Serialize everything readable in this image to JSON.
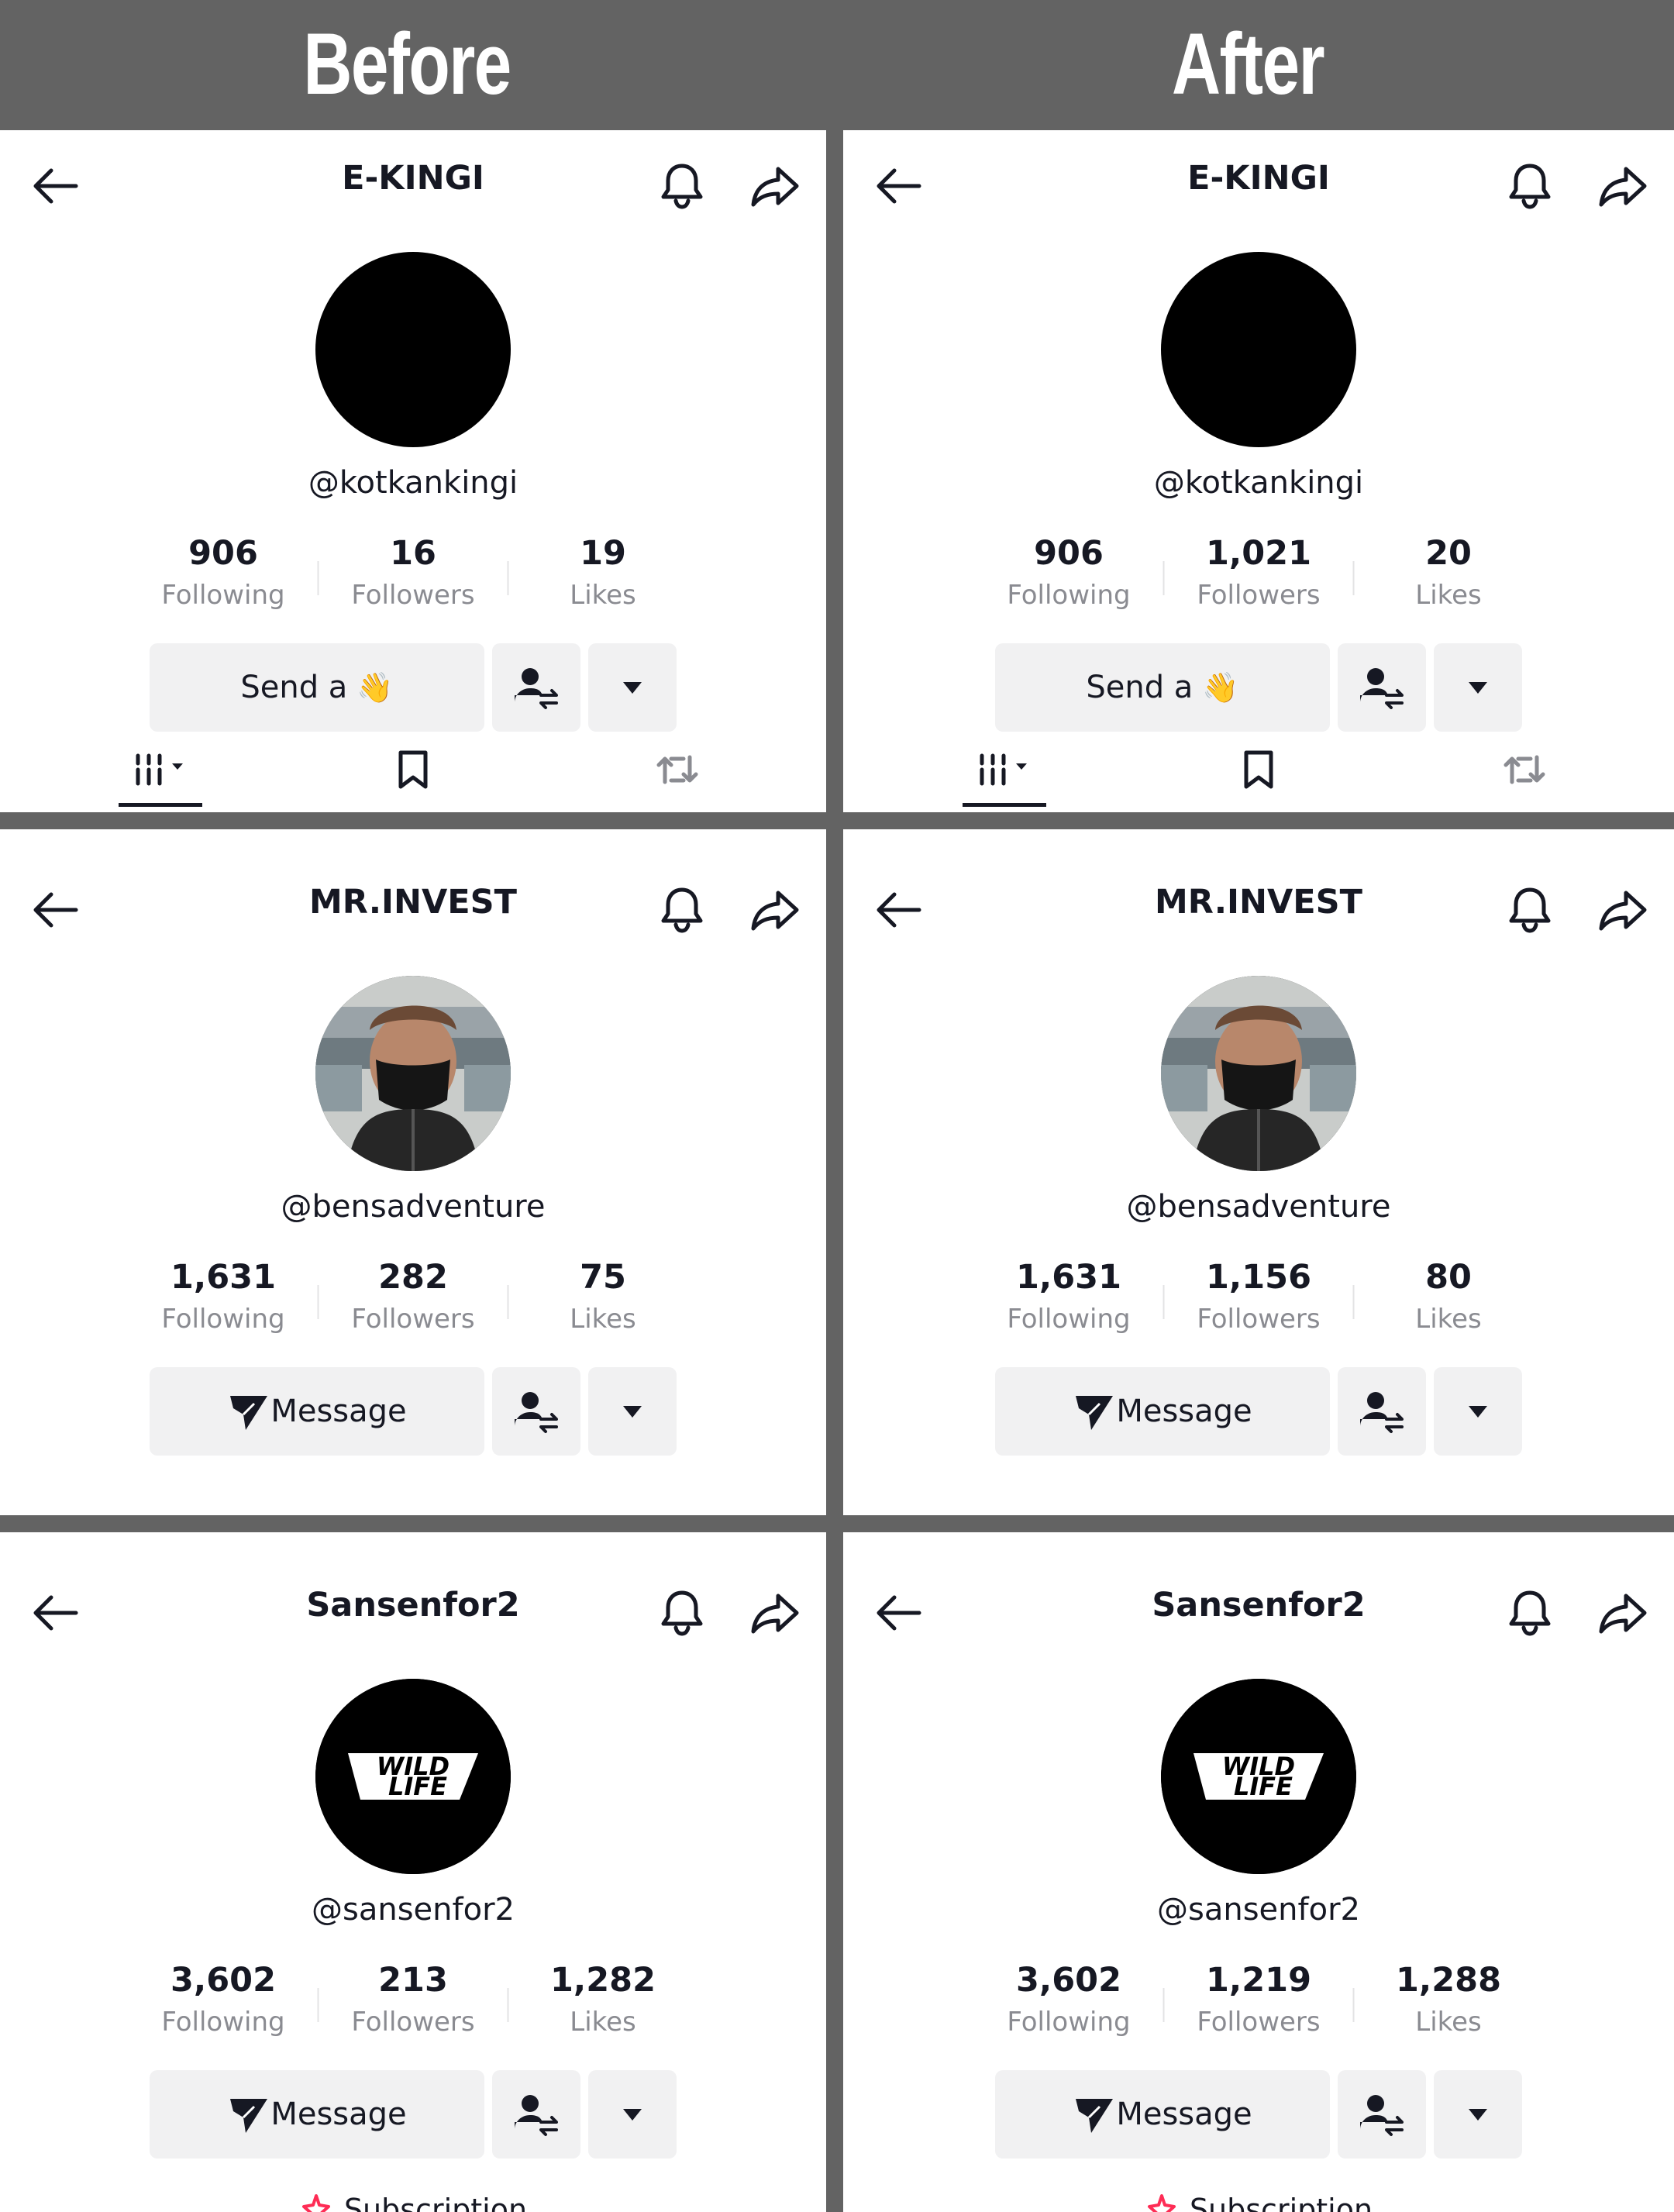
{
  "headers": {
    "before": "Before",
    "after": "After"
  },
  "panels": [
    {
      "title": "E-KINGI",
      "handle": "@kotkankingi",
      "avatar": "black-circle",
      "stats": [
        {
          "num": "906",
          "label": "Following"
        },
        {
          "num": "16",
          "label": "Followers"
        },
        {
          "num": "19",
          "label": "Likes"
        }
      ],
      "action_label": "Send a",
      "action_emoji": "👋"
    },
    {
      "title": "E-KINGI",
      "handle": "@kotkankingi",
      "avatar": "black-circle",
      "stats": [
        {
          "num": "906",
          "label": "Following"
        },
        {
          "num": "1,021",
          "label": "Followers"
        },
        {
          "num": "20",
          "label": "Likes"
        }
      ],
      "action_label": "Send a",
      "action_emoji": "👋"
    },
    {
      "title": "MR.INVEST",
      "handle": "@bensadventure",
      "avatar": "person-photo",
      "stats": [
        {
          "num": "1,631",
          "label": "Following"
        },
        {
          "num": "282",
          "label": "Followers"
        },
        {
          "num": "75",
          "label": "Likes"
        }
      ],
      "action_label": "Message"
    },
    {
      "title": "MR.INVEST",
      "handle": "@bensadventure",
      "avatar": "person-photo",
      "stats": [
        {
          "num": "1,631",
          "label": "Following"
        },
        {
          "num": "1,156",
          "label": "Followers"
        },
        {
          "num": "80",
          "label": "Likes"
        }
      ],
      "action_label": "Message"
    },
    {
      "title": "Sansenfor2",
      "handle": "@sansenfor2",
      "avatar": "wild-life-logo",
      "logo_text": [
        "WILD",
        "LIFE"
      ],
      "stats": [
        {
          "num": "3,602",
          "label": "Following"
        },
        {
          "num": "213",
          "label": "Followers"
        },
        {
          "num": "1,282",
          "label": "Likes"
        }
      ],
      "action_label": "Message",
      "subscription_label": "Subscription"
    },
    {
      "title": "Sansenfor2",
      "handle": "@sansenfor2",
      "avatar": "wild-life-logo",
      "logo_text": [
        "WILD",
        "LIFE"
      ],
      "stats": [
        {
          "num": "3,602",
          "label": "Following"
        },
        {
          "num": "1,219",
          "label": "Followers"
        },
        {
          "num": "1,288",
          "label": "Likes"
        }
      ],
      "action_label": "Message",
      "subscription_label": "Subscription"
    }
  ],
  "colors": {
    "divider": "#636363",
    "button_bg": "#f1f1f2",
    "text": "#161823",
    "muted": "#8a8b91",
    "subscription": "#fe2c55"
  }
}
